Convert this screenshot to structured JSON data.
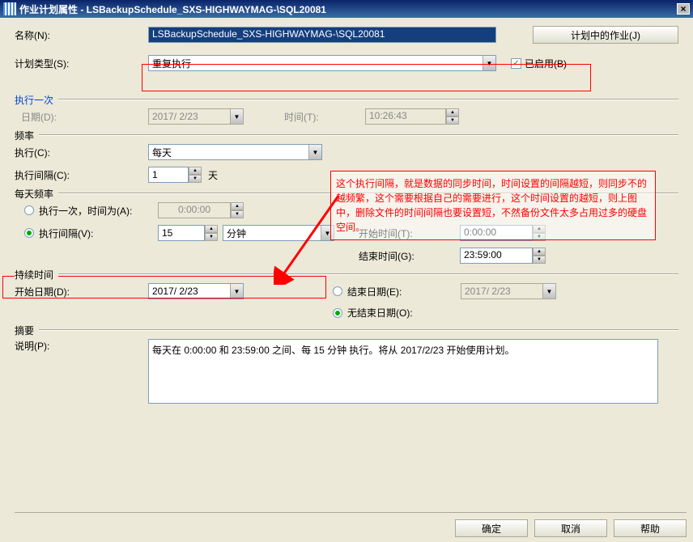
{
  "window": {
    "title": "作业计划属性 - LSBackupSchedule_SXS-HIGHWAYMAG-\\SQL20081"
  },
  "name": {
    "label": "名称(N):",
    "value": "LSBackupSchedule_SXS-HIGHWAYMAG-\\SQL20081"
  },
  "scheduleButton": "计划中的作业(J)",
  "scheduleType": {
    "label": "计划类型(S):",
    "value": "重复执行",
    "enabledLabel": "已启用(B)"
  },
  "once": {
    "group": "执行一次",
    "dateLabel": "日期(D):",
    "dateValue": "2017/ 2/23",
    "timeLabel": "时间(T):",
    "timeValue": "10:26:43"
  },
  "freq": {
    "group": "频率",
    "execLabel": "执行(C):",
    "execValue": "每天",
    "intervalLabel": "执行间隔(C):",
    "intervalValue": "1",
    "intervalUnit": "天"
  },
  "daily": {
    "group": "每天频率",
    "onceLabel": "执行一次，时间为(A):",
    "onceValue": "0:00:00",
    "intervalLabel": "执行间隔(V):",
    "intervalValue": "15",
    "intervalUnit": "分钟",
    "startLabel": "开始时间(T):",
    "startValue": " 0:00:00",
    "endLabel": "结束时间(G):",
    "endValue": "23:59:00"
  },
  "duration": {
    "group": "持续时间",
    "startDateLabel": "开始日期(D):",
    "startDateValue": "2017/ 2/23",
    "endDateLabel": "结束日期(E):",
    "endDateValue": "2017/ 2/23",
    "noEndLabel": "无结束日期(O):"
  },
  "summary": {
    "group": "摘要",
    "descLabel": "说明(P):",
    "descValue": "每天在 0:00:00 和 23:59:00 之间、每 15 分钟 执行。将从 2017/2/23 开始使用计划。"
  },
  "buttons": {
    "ok": "确定",
    "cancel": "取消",
    "help": "帮助"
  },
  "annotation": "这个执行间隔，就是数据的同步时间，时间设置的间隔越短，则同步不的越频繁，这个需要根据自己的需要进行，这个时间设置的越短，则上图中，删除文件的时间间隔也要设置短，不然备份文件太多占用过多的硬盘空间。"
}
